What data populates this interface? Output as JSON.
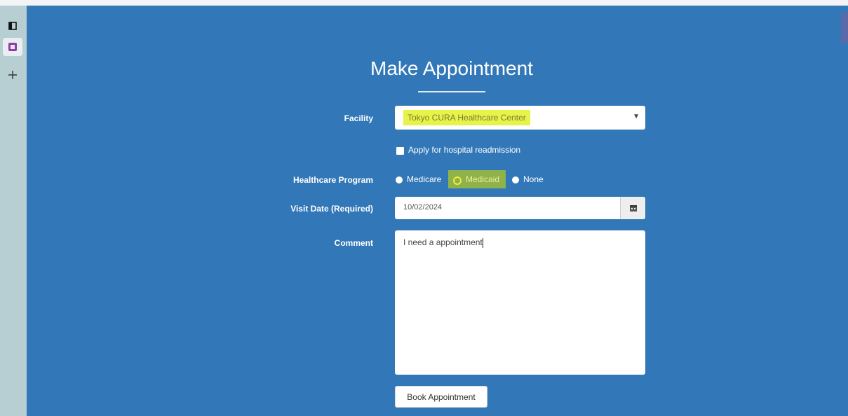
{
  "form": {
    "title": "Make Appointment",
    "facility_label": "Facility",
    "facility_value": "Tokyo CURA Healthcare Center",
    "readmission_label": "Apply for hospital readmission",
    "program_label": "Healthcare Program",
    "programs": [
      {
        "label": "Medicare",
        "selected": false
      },
      {
        "label": "Medicaid",
        "selected": true
      },
      {
        "label": "None",
        "selected": false
      }
    ],
    "visit_date_label": "Visit Date (Required)",
    "visit_date_value": "10/02/2024",
    "comment_label": "Comment",
    "comment_value": "I need a appointment",
    "book_button_label": "Book Appointment"
  },
  "colors": {
    "background": "#3278b8",
    "highlight_yellow": "#e8f34a",
    "highlight_green": "#8fb24a",
    "sidebar": "#b7cfd2"
  },
  "icons": [
    "sidebar-toggle-icon",
    "tab-icon",
    "plus-icon",
    "chevron-down-icon",
    "calendar-icon"
  ]
}
